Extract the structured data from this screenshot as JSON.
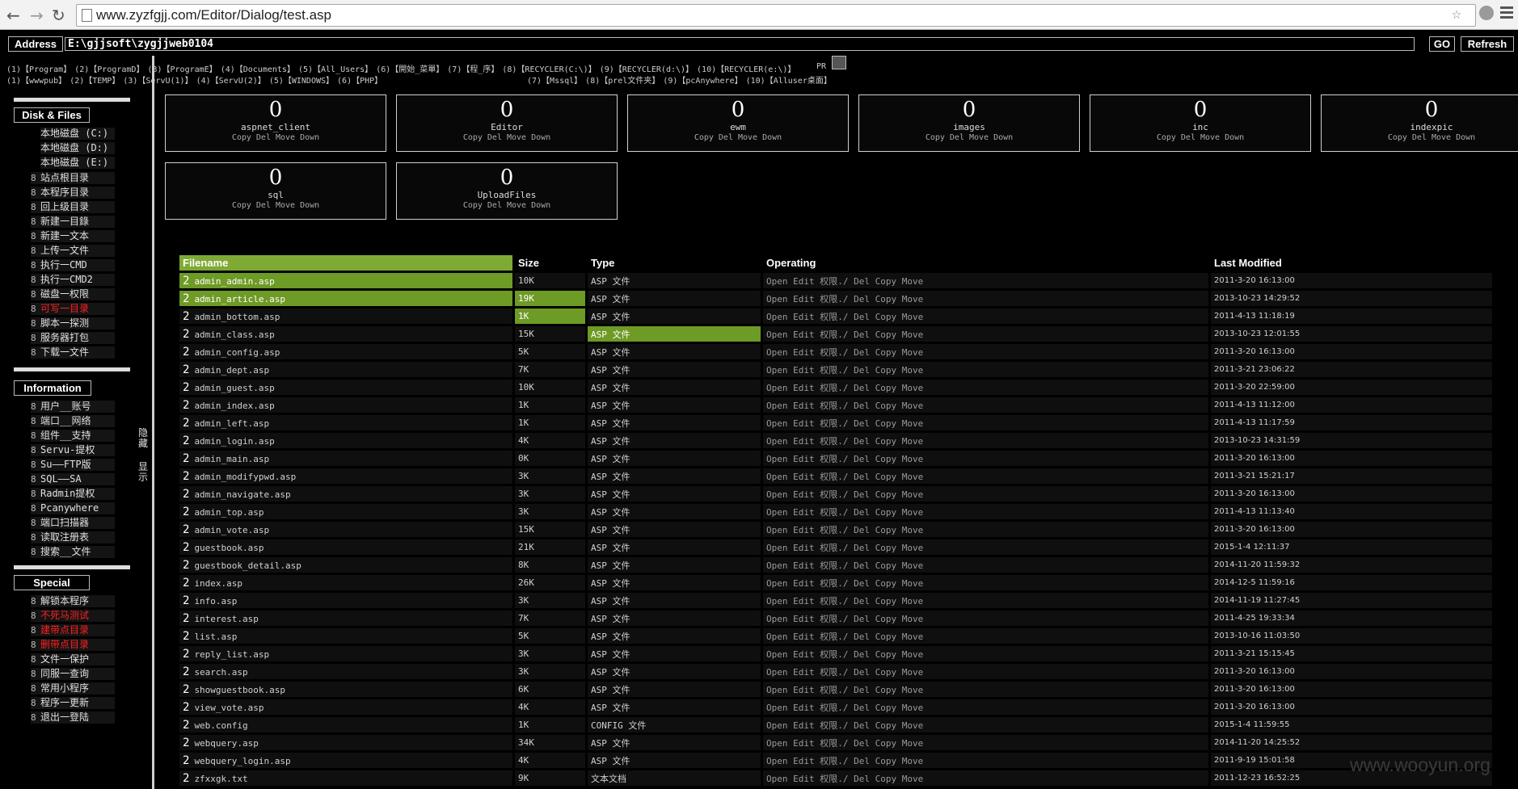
{
  "browser": {
    "url": "www.zyzfgjj.com/Editor/Dialog/test.asp"
  },
  "address": {
    "label": "Address",
    "value": "E:\\gjjsoft\\zygjjweb0104",
    "go": "GO",
    "refresh": "Refresh"
  },
  "quick_row1": [
    "(1)【Program】",
    "(2)【ProgramD】",
    "(3)【ProgramE】",
    "(4)【Documents】",
    "(5)【All_Users】",
    "(6)【開始_菜單】",
    "(7)【程_序】",
    "(8)【RECYCLER(C:\\)】",
    "(9)【RECYCLER(d:\\)】",
    "(10)【RECYCLER(e:\\)】"
  ],
  "quick_row2a": [
    "(1)【wwwpub】",
    "(2)【TEMP】",
    "(3)【ServU(1)】",
    "(4)【ServU(2)】",
    "(5)【WINDOWS】",
    "(6)【PHP】"
  ],
  "quick_row2b": [
    "(7)【Mssql】",
    "(8)【prel文件夹】",
    "(9)【pcAnywhere】",
    "(10)【Alluser桌面】"
  ],
  "pr_label": "PR",
  "sidebar": {
    "disk_title": "Disk & Files",
    "disks": [
      "本地磁盘 (C:)",
      "本地磁盘 (D:)",
      "本地磁盘 (E:)"
    ],
    "files": [
      {
        "n": "8",
        "l": "站点根目录"
      },
      {
        "n": "8",
        "l": "本程序目录"
      },
      {
        "n": "8",
        "l": "回上级目录"
      },
      {
        "n": "8",
        "l": "新建一目錄"
      },
      {
        "n": "8",
        "l": "新建一文本"
      },
      {
        "n": "8",
        "l": "上传一文件"
      },
      {
        "n": "8",
        "l": "执行一CMD"
      },
      {
        "n": "8",
        "l": "执行一CMD2"
      },
      {
        "n": "8",
        "l": "磁盘一权限"
      },
      {
        "n": "8",
        "l": "可写一目录",
        "red": true
      },
      {
        "n": "8",
        "l": "脚本一探测"
      },
      {
        "n": "8",
        "l": "服务器打包"
      },
      {
        "n": "8",
        "l": "下载一文件"
      }
    ],
    "info_title": "Information",
    "info": [
      {
        "n": "8",
        "l": "用户__账号"
      },
      {
        "n": "8",
        "l": "端口__网络"
      },
      {
        "n": "8",
        "l": "组件__支持"
      },
      {
        "n": "8",
        "l": "Servu-提权"
      },
      {
        "n": "8",
        "l": "Su——FTP版"
      },
      {
        "n": "8",
        "l": "SQL——SA"
      },
      {
        "n": "8",
        "l": "Radmin提权"
      },
      {
        "n": "8",
        "l": "Pcanywhere"
      },
      {
        "n": "8",
        "l": "端口扫描器"
      },
      {
        "n": "8",
        "l": "读取注册表"
      },
      {
        "n": "8",
        "l": "搜索__文件"
      }
    ],
    "special_title": "Special",
    "special": [
      {
        "n": "8",
        "l": "解锁本程序"
      },
      {
        "n": "8",
        "l": "不死马测试",
        "red": true
      },
      {
        "n": "8",
        "l": "建带点目录",
        "red": true
      },
      {
        "n": "8",
        "l": "删带点目录",
        "red": true
      },
      {
        "n": "8",
        "l": "文件一保护"
      },
      {
        "n": "8",
        "l": "同服一查询"
      },
      {
        "n": "8",
        "l": "常用小程序"
      },
      {
        "n": "8",
        "l": "程序一更新"
      },
      {
        "n": "8",
        "l": "退出一登陆"
      }
    ],
    "hide_label": "隐藏",
    "show_label": "显示"
  },
  "folders": [
    {
      "count": "0",
      "name": "aspnet_client",
      "ops": "Copy Del Move Down"
    },
    {
      "count": "0",
      "name": "Editor",
      "ops": "Copy Del Move Down"
    },
    {
      "count": "0",
      "name": "ewm",
      "ops": "Copy Del Move Down"
    },
    {
      "count": "0",
      "name": "images",
      "ops": "Copy Del Move Down"
    },
    {
      "count": "0",
      "name": "inc",
      "ops": "Copy Del Move Down"
    },
    {
      "count": "0",
      "name": "indexpic",
      "ops": "Copy Del Move Down"
    },
    {
      "count": "0",
      "name": "sql",
      "ops": "Copy Del Move Down"
    },
    {
      "count": "0",
      "name": "UploadFiles",
      "ops": "Copy Del Move Down"
    }
  ],
  "table": {
    "headers": [
      "Filename",
      "Size",
      "Type",
      "Operating",
      "Last Modified"
    ],
    "ops": "Open Edit 权限./ Del Copy Move",
    "icon": "2",
    "rows": [
      [
        "admin_admin.asp",
        "10K",
        "ASP 文件",
        "2011-3-20 16:13:00"
      ],
      [
        "admin_article.asp",
        "19K",
        "ASP 文件",
        "2013-10-23 14:29:52"
      ],
      [
        "admin_bottom.asp",
        "1K",
        "ASP 文件",
        "2011-4-13 11:18:19"
      ],
      [
        "admin_class.asp",
        "15K",
        "ASP 文件",
        "2013-10-23 12:01:55"
      ],
      [
        "admin_config.asp",
        "5K",
        "ASP 文件",
        "2011-3-20 16:13:00"
      ],
      [
        "admin_dept.asp",
        "7K",
        "ASP 文件",
        "2011-3-21 23:06:22"
      ],
      [
        "admin_guest.asp",
        "10K",
        "ASP 文件",
        "2011-3-20 22:59:00"
      ],
      [
        "admin_index.asp",
        "1K",
        "ASP 文件",
        "2011-4-13 11:12:00"
      ],
      [
        "admin_left.asp",
        "1K",
        "ASP 文件",
        "2011-4-13 11:17:59"
      ],
      [
        "admin_login.asp",
        "4K",
        "ASP 文件",
        "2013-10-23 14:31:59"
      ],
      [
        "admin_main.asp",
        "0K",
        "ASP 文件",
        "2011-3-20 16:13:00"
      ],
      [
        "admin_modifypwd.asp",
        "3K",
        "ASP 文件",
        "2011-3-21 15:21:17"
      ],
      [
        "admin_navigate.asp",
        "3K",
        "ASP 文件",
        "2011-3-20 16:13:00"
      ],
      [
        "admin_top.asp",
        "3K",
        "ASP 文件",
        "2011-4-13 11:13:40"
      ],
      [
        "admin_vote.asp",
        "15K",
        "ASP 文件",
        "2011-3-20 16:13:00"
      ],
      [
        "guestbook.asp",
        "21K",
        "ASP 文件",
        "2015-1-4 12:11:37"
      ],
      [
        "guestbook_detail.asp",
        "8K",
        "ASP 文件",
        "2014-11-20 11:59:32"
      ],
      [
        "index.asp",
        "26K",
        "ASP 文件",
        "2014-12-5 11:59:16"
      ],
      [
        "info.asp",
        "3K",
        "ASP 文件",
        "2014-11-19 11:27:45"
      ],
      [
        "interest.asp",
        "7K",
        "ASP 文件",
        "2011-4-25 19:33:34"
      ],
      [
        "list.asp",
        "5K",
        "ASP 文件",
        "2013-10-16 11:03:50"
      ],
      [
        "reply_list.asp",
        "3K",
        "ASP 文件",
        "2011-3-21 15:15:45"
      ],
      [
        "search.asp",
        "3K",
        "ASP 文件",
        "2011-3-20 16:13:00"
      ],
      [
        "showguestbook.asp",
        "6K",
        "ASP 文件",
        "2011-3-20 16:13:00"
      ],
      [
        "view_vote.asp",
        "4K",
        "ASP 文件",
        "2011-3-20 16:13:00"
      ],
      [
        "web.config",
        "1K",
        "CONFIG 文件",
        "2015-1-4 11:59:55"
      ],
      [
        "webquery.asp",
        "34K",
        "ASP 文件",
        "2014-11-20 14:25:52"
      ],
      [
        "webquery_login.asp",
        "4K",
        "ASP 文件",
        "2011-9-19 15:01:58"
      ],
      [
        "zfxxgk.txt",
        "9K",
        "文本文档",
        "2011-12-23 16:52:25"
      ]
    ]
  },
  "watermark": "www.wooyun.org"
}
